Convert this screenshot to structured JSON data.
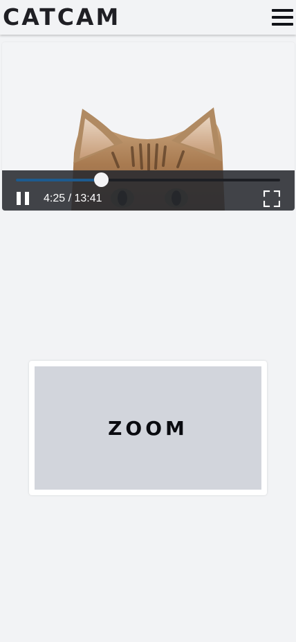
{
  "header": {
    "logo_text": "CATCAM",
    "menu_icon": "hamburger-menu-icon"
  },
  "player": {
    "current_time": "4:25",
    "duration": "13:41",
    "time_display": "4:25 / 13:41",
    "progress_fraction": 0.323,
    "pause_icon": "pause-icon",
    "fullscreen_icon": "fullscreen-icon",
    "accent_color": "#1d5b8f"
  },
  "zoom": {
    "label": "ZOOM"
  }
}
